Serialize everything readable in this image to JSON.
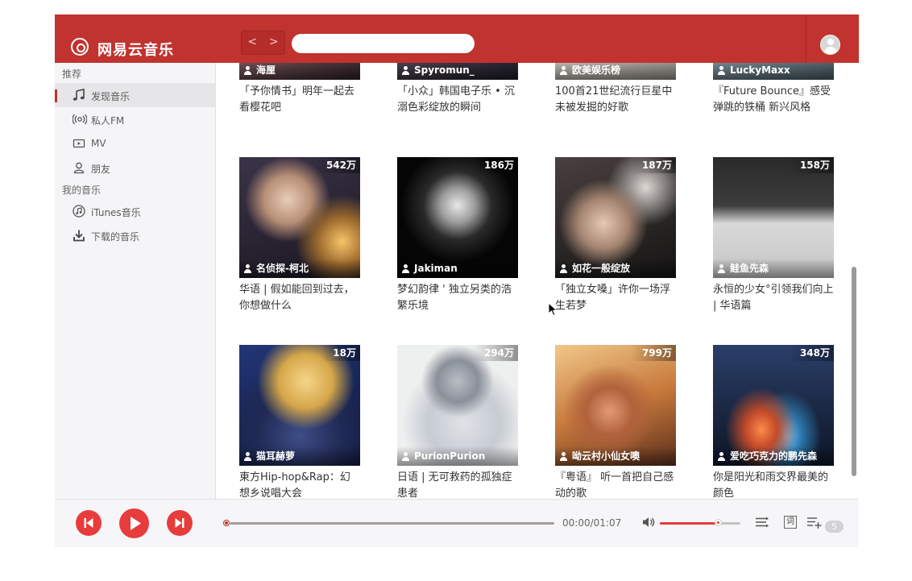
{
  "app": {
    "title": "网易云音乐"
  },
  "header": {
    "back_label": "<",
    "forward_label": ">",
    "search_value": "",
    "search_placeholder": ""
  },
  "sidebar": {
    "sections": [
      {
        "header": "推荐",
        "items": [
          {
            "label": "发现音乐",
            "icon": "music-note-icon",
            "active": true
          },
          {
            "label": "私人FM",
            "icon": "radio-icon",
            "active": false
          },
          {
            "label": "MV",
            "icon": "mv-icon",
            "active": false
          },
          {
            "label": "朋友",
            "icon": "friends-icon",
            "active": false
          }
        ]
      },
      {
        "header": "我的音乐",
        "items": [
          {
            "label": "iTunes音乐",
            "icon": "itunes-icon",
            "active": false
          },
          {
            "label": "下载的音乐",
            "icon": "download-icon",
            "active": false
          }
        ]
      }
    ]
  },
  "playlists": [
    {
      "creator": "海厘",
      "plays": "",
      "title": "「予你情书」明年一起去看樱花吧"
    },
    {
      "creator": "Spyromun_",
      "plays": "",
      "title": "「小众」韩国电子乐 • 沉溺色彩绽放的瞬间"
    },
    {
      "creator": "欧美娱乐榜",
      "plays": "",
      "title": "100首21世纪流行巨星中未被发掘的好歌"
    },
    {
      "creator": "LuckyMaxx",
      "plays": "",
      "title": "『Future Bounce』感受弹跳的铁桶 新兴风格"
    },
    {
      "creator": "名侦探-柯北",
      "plays": "542万",
      "title": "华语 | 假如能回到过去，你想做什么"
    },
    {
      "creator": "Jakiman",
      "plays": "186万",
      "title": "梦幻韵律 ' 独立另类的浩繁乐境"
    },
    {
      "creator": "如花一般绽放",
      "plays": "187万",
      "title": "「独立女嗓」许你一场浮生若梦"
    },
    {
      "creator": "鲑鱼先森",
      "plays": "158万",
      "title": "永恒的少女°引领我们向上 | 华语篇"
    },
    {
      "creator": "猫耳赫萝",
      "plays": "18万",
      "title": "東方Hip-hop&Rap：幻想乡说唱大会"
    },
    {
      "creator": "PurionPurion",
      "plays": "294万",
      "title": "日语 | 无可救药的孤独症患者"
    },
    {
      "creator": "呦云村小仙女噢",
      "plays": "799万",
      "title": "『粤语』 听一首把自己感动的歌"
    },
    {
      "creator": "爱吃巧克力的鹏先森",
      "plays": "348万",
      "title": "你是阳光和雨交界最美的颜色"
    }
  ],
  "player": {
    "time": "00:00/01:07",
    "progress": 0.0,
    "volume": 0.72,
    "lyric_label": "词",
    "queue_count": "5",
    "accent": "#e83c3c",
    "brand": "#c0332f"
  }
}
